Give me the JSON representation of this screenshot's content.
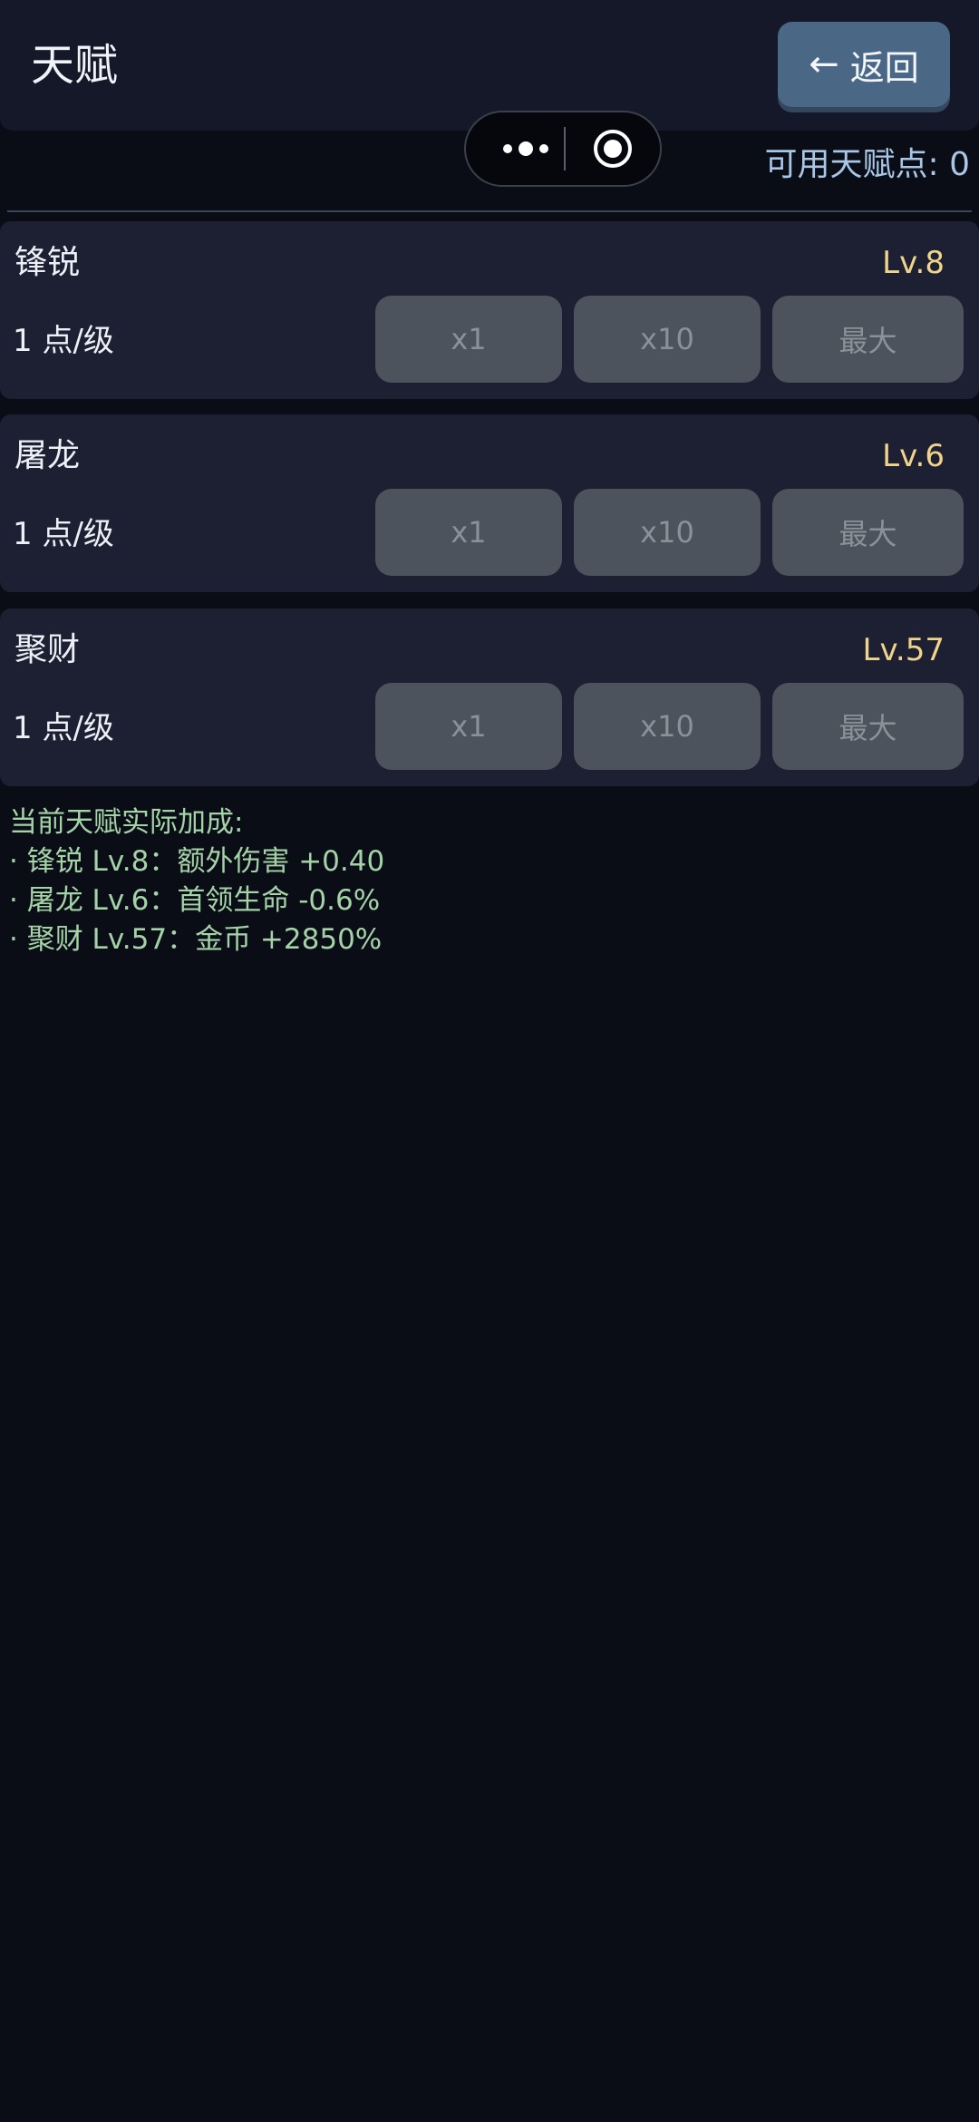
{
  "header": {
    "title": "天赋",
    "back_label": "返回",
    "back_arrow": "←"
  },
  "points_label": "可用天赋点: 0",
  "talents": [
    {
      "name": "锋锐",
      "level": "Lv.8",
      "cost": "1 点/级",
      "buttons": [
        "x1",
        "x10",
        "最大"
      ]
    },
    {
      "name": "屠龙",
      "level": "Lv.6",
      "cost": "1 点/级",
      "buttons": [
        "x1",
        "x10",
        "最大"
      ]
    },
    {
      "name": "聚财",
      "level": "Lv.57",
      "cost": "1 点/级",
      "buttons": [
        "x1",
        "x10",
        "最大"
      ]
    }
  ],
  "summary": {
    "heading": "当前天赋实际加成:",
    "lines": [
      "· 锋锐 Lv.8：额外伤害 +0.40",
      "· 屠龙 Lv.6：首领生命 -0.6%",
      "· 聚财 Lv.57：金币 +2850%"
    ]
  },
  "colors": {
    "background": "#0a0d16",
    "card": "#1d2033",
    "level": "#f0d48c",
    "points": "#a9c6e6",
    "summary": "#a5d3a8",
    "back_button": "#4a6886",
    "disabled_button": "#4c535c"
  },
  "icons": {
    "capsule_more": "more-dots-icon",
    "capsule_close": "record-target-icon",
    "back": "left-arrow-icon"
  }
}
